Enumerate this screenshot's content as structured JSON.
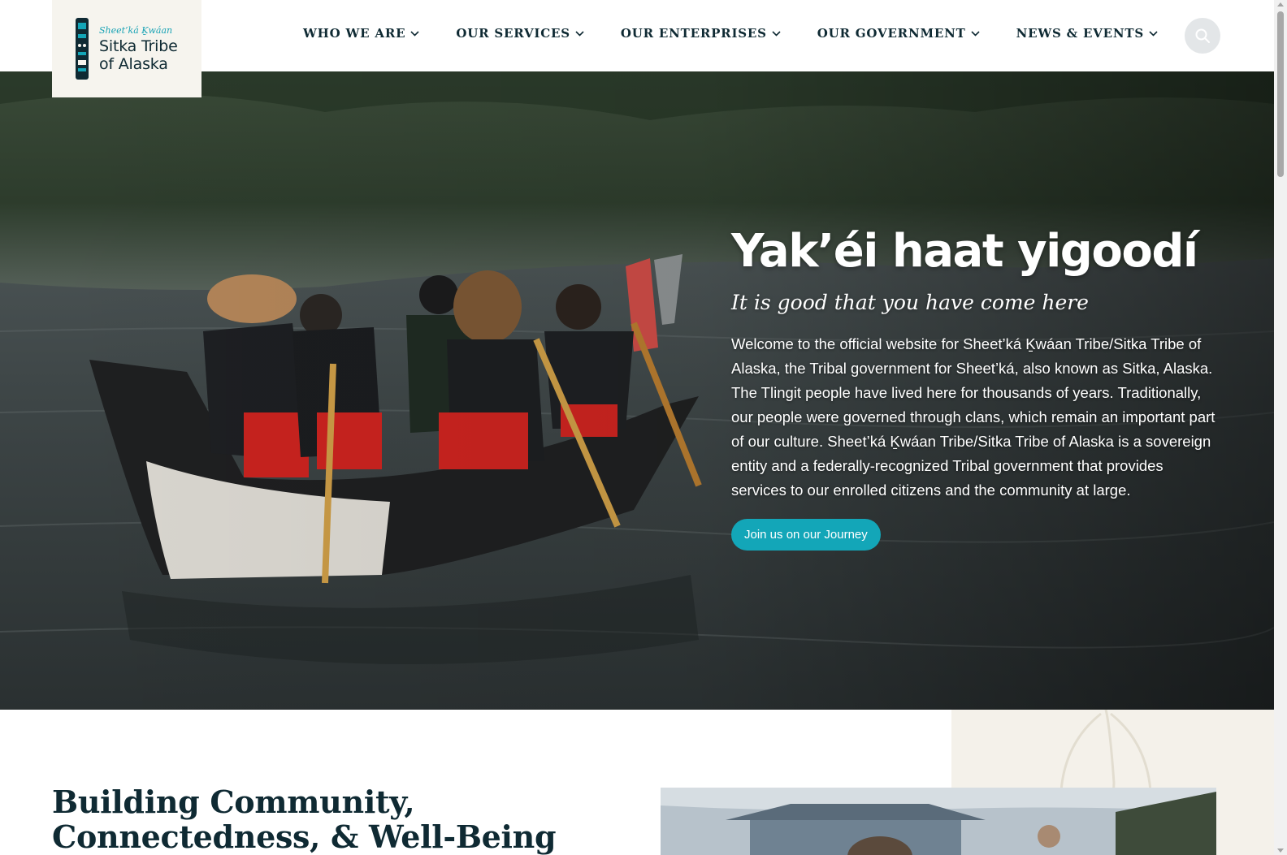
{
  "site": {
    "logo_sub": "Sheet’ká Ḵwáan",
    "logo_line1": "Sitka Tribe",
    "logo_line2": "of Alaska"
  },
  "nav": {
    "items": [
      {
        "label": "WHO WE ARE",
        "icon": "chevron-down-icon"
      },
      {
        "label": "OUR SERVICES",
        "icon": "chevron-down-icon"
      },
      {
        "label": "OUR ENTERPRISES",
        "icon": "chevron-down-icon"
      },
      {
        "label": "OUR GOVERNMENT",
        "icon": "chevron-down-icon"
      },
      {
        "label": "NEWS & EVENTS",
        "icon": "chevron-down-icon"
      }
    ],
    "search_icon": "search-icon"
  },
  "hero": {
    "title": "Yak’éi haat yigoodí",
    "subtitle": "It is good that you have come here",
    "body": "Welcome to the official website for Sheet’ká Ḵwáan Tribe/Sitka Tribe of Alaska, the Tribal government for Sheet’ká, also known as Sitka, Alaska. The Tlingit people have lived here for thousands of years. Traditionally, our people were governed through clans, which remain an important part of our culture. Sheet’ká Ḵwáan Tribe/Sitka Tribe of Alaska is a sovereign entity and a federally-recognized Tribal government that provides services to our enrolled citizens and the community at large.",
    "cta": "Join us on our Journey"
  },
  "section": {
    "title_line1": "Building Community,",
    "title_line2": "Connectedness, & Well-Being"
  },
  "colors": {
    "accent": "#13a6b8",
    "text_dark": "#0f2a33",
    "logo_bg": "#f6f4ee"
  }
}
